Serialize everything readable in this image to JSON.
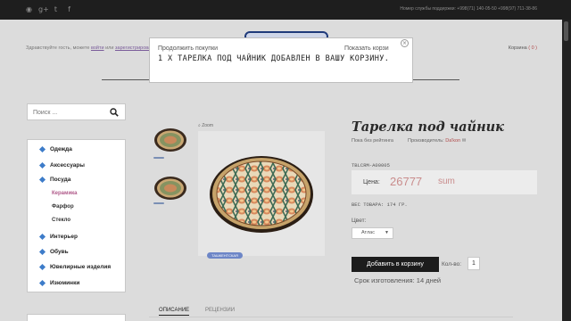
{
  "topbar": {
    "social_icons": [
      "rss-icon",
      "google-plus-icon",
      "twitter-icon",
      "facebook-icon"
    ],
    "support": "Номер службы поддержки: +998(71) 140-05-50 +998(97) 711-38-86"
  },
  "header": {
    "greeting_prefix": "Здравствуйте гость, можете",
    "login_link": "войти",
    "greeting_mid": "или",
    "register_link": "зарегистрироваться",
    "cart_label": "Корзина",
    "cart_count": "( 0 )"
  },
  "search": {
    "placeholder": "Поиск ..."
  },
  "categories": [
    {
      "label": "Одежда"
    },
    {
      "label": "Аксессуары"
    },
    {
      "label": "Посуда"
    },
    {
      "label": "Интерьер"
    },
    {
      "label": "Обувь"
    },
    {
      "label": "Ювелирные изделия"
    },
    {
      "label": "Изюминки"
    }
  ],
  "subcategories": [
    {
      "label": "Керамика",
      "active": true
    },
    {
      "label": "Фарфор",
      "active": false
    },
    {
      "label": "Стекло",
      "active": false
    }
  ],
  "gallery": {
    "zoom_label": "Zoom",
    "tag": "ТАШКЕНТСКАЯ"
  },
  "product": {
    "title": "Тарелка под чайник",
    "rating": "Пока без рейтинга",
    "maker_label": "Производитель:",
    "maker": "Da'kon",
    "sku": "TBLCRM-A00005",
    "price_label": "Цена:",
    "price": "26777",
    "currency": "sum",
    "weight": "ВЕС ТОВАРА: 174 ГР.",
    "color_label": "Цвет:",
    "color_value": "Атлас",
    "add_button": "Добавить в корзину",
    "qty_label": "Кол-во:",
    "qty_value": "1",
    "lead_time": "Срок изготовления: 14 дней"
  },
  "tabs": [
    {
      "label": "ОПИСАНИЕ"
    },
    {
      "label": "РЕЦЕНЗИИ"
    }
  ],
  "popup": {
    "continue": "Продолжить покупки",
    "goto_cart": "Показать корзи",
    "message": "1 X ТАРЕЛКА ПОД ЧАЙНИК ДОБАВЛЕН В ВАШУ КОРЗИНУ.",
    "close": "×"
  },
  "colors": {
    "accent_blue": "#3d7cc9",
    "price": "#c98c8c",
    "active_sub": "#b05a8a",
    "topbar": "#1e1e1e"
  }
}
